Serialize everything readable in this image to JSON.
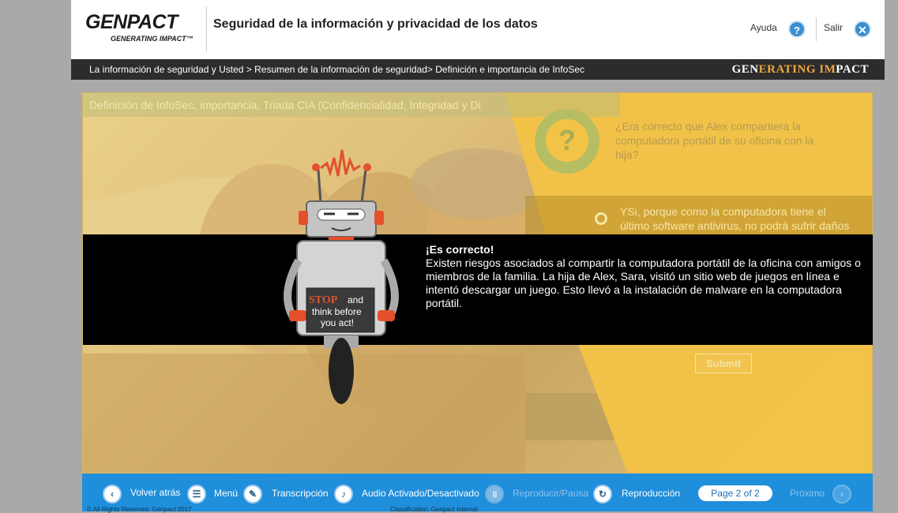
{
  "header": {
    "logo_brand": "GENPACT",
    "logo_tagline": "GENERATING IMPACT™",
    "course_title": "Seguridad de la información y privacidad de los datos",
    "help_label": "Ayuda",
    "help_icon": "?",
    "exit_label": "Salir",
    "exit_icon": "✕"
  },
  "breadcrumb": {
    "text": "La información de seguridad y Usted > Resumen de la información de seguridad> Definición e importancia de InfoSec",
    "logo_part1": "GEN",
    "logo_part2": "ERATING ",
    "logo_part3": "IM",
    "logo_part4": "PACT"
  },
  "slide": {
    "title": "Definición de InfoSec, importancia, Triada CIA (Confidencialidad, Integridad y Di",
    "question_icon": "?",
    "question": "¿Era correcto que Alex compartiera la computadora portátil de su oficina con la hija?",
    "option_text": "YSi, porque como la computadora tiene el último software antivirus, no podrá sufrir daños",
    "submit_label": "Submit"
  },
  "feedback": {
    "title": "¡Es correcto!",
    "body": "Existen riesgos asociados al compartir la computadora portátil de la oficina con amigos o miembros de la familia. La hija de Alex, Sara, visitó un sitio web de juegos en línea e intentó descargar un juego. Esto llevó a la instalación de malware en la computadora portátil."
  },
  "robot": {
    "sign_stop": "STOP",
    "sign_and": " and",
    "sign_line2": "think before",
    "sign_line3": "you act!"
  },
  "nav": {
    "back_label": "Volver atrás",
    "menu_label": "Menú",
    "transcript_label": "Transcripción",
    "audio_label": "Audio Activado/Desactivado",
    "playpause_label": "Reproducir/Pausa",
    "replay_label": "Reproducción",
    "page_label": "Page 2 of 2",
    "next_label": "Próximo",
    "copyright": "© All Rights Reserved. Genpact 2017",
    "classification": "Classification: Genpact Internal"
  },
  "colors": {
    "nav_blue": "#1f8edb",
    "accent_orange": "#f2a93b",
    "panel_yellow": "#f3c347"
  }
}
